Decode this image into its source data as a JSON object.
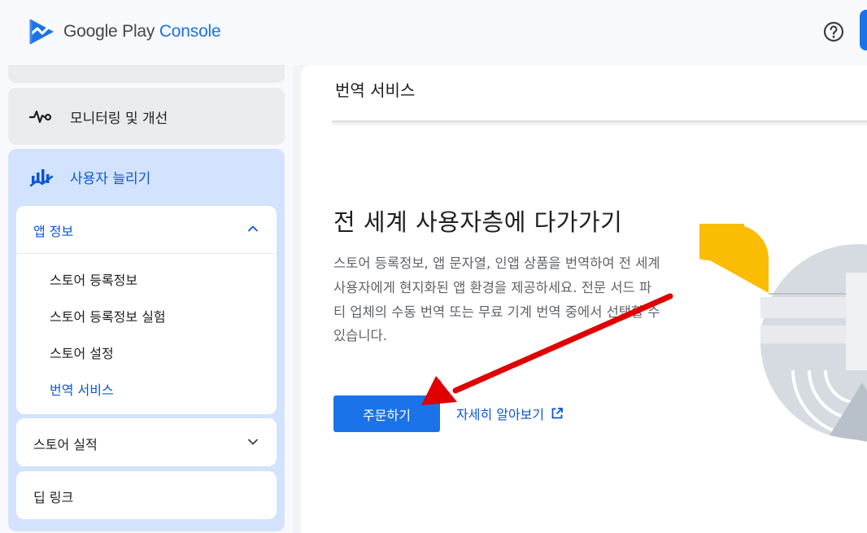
{
  "header": {
    "brand_google": "Google Play",
    "brand_console": "Console",
    "help_icon": "help-circle-icon",
    "brand_color": "#1a73e8"
  },
  "sidebar": {
    "monitor": {
      "label": "모니터링 및 개선",
      "icon": "vitals-pulse-icon"
    },
    "grow": {
      "label": "사용자 늘리기",
      "icon": "growth-chart-icon",
      "app_info": {
        "title": "앱 정보",
        "items": [
          {
            "label": "스토어 등록정보"
          },
          {
            "label": "스토어 등록정보 실험"
          },
          {
            "label": "스토어 설정"
          },
          {
            "label": "번역 서비스"
          }
        ]
      },
      "store_performance": {
        "title": "스토어 실적"
      },
      "deep_links": {
        "title": "딥 링크"
      }
    }
  },
  "main": {
    "page_title": "번역 서비스",
    "hero_title": "전 세계 사용자층에 다가가기",
    "hero_description": "스토어 등록정보, 앱 문자열, 인앱 상품을 번역하여 전 세계 사용자에게 현지화된 앱 환경을 제공하세요. 전문 서드 파티 업체의 수동 번역 또는 무료 기계 번역 중에서 선택할 수 있습니다.",
    "order_button": "주문하기",
    "learn_more": "자세히 알아보기",
    "learn_more_icon": "open-in-new-icon"
  },
  "colors": {
    "accent": "#1a73e8",
    "active_text": "#0b57d0",
    "nav_active_bg": "#d3e3fd",
    "annotation_arrow": "#e00000"
  }
}
